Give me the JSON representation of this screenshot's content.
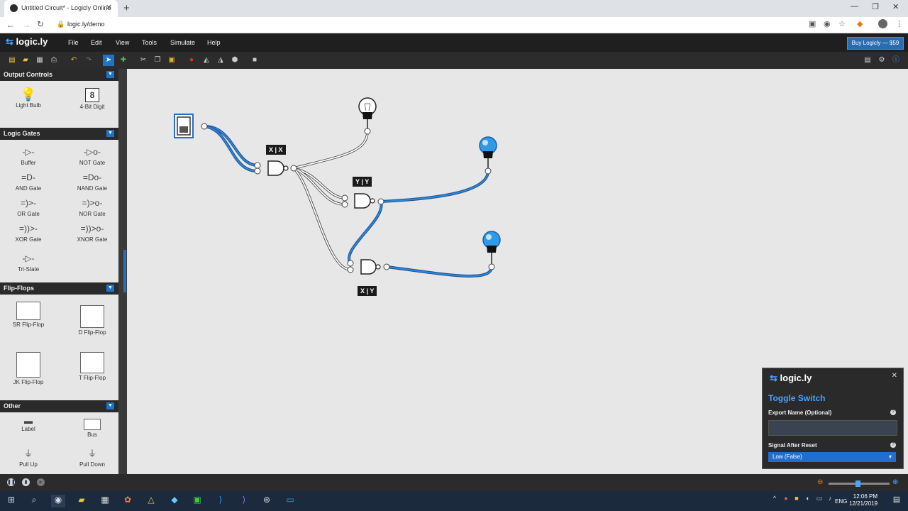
{
  "browser": {
    "tab_title": "Untitled Circuit* - Logicly Online",
    "tab_close": "✕",
    "new_tab": "+",
    "url": "logic.ly/demo",
    "window_controls": [
      "—",
      "❐",
      "✕"
    ]
  },
  "app": {
    "logo": "logic.ly",
    "menu": [
      "File",
      "Edit",
      "View",
      "Tools",
      "Simulate",
      "Help"
    ],
    "buy_button": "Buy Logicly — $59"
  },
  "sidebar": {
    "sections": [
      {
        "title": "Output Controls",
        "items": [
          "Light Bulb",
          "4-Bit Digit"
        ]
      },
      {
        "title": "Logic Gates",
        "items": [
          "Buffer",
          "NOT Gate",
          "AND Gate",
          "NAND Gate",
          "OR Gate",
          "NOR Gate",
          "XOR Gate",
          "XNOR Gate",
          "Tri-State"
        ]
      },
      {
        "title": "Flip-Flops",
        "items": [
          "SR Flip-Flop",
          "D Flip-Flop",
          "JK Flip-Flop",
          "T Flip-Flop"
        ]
      },
      {
        "title": "Other",
        "items": [
          "Label",
          "Bus",
          "Pull Up",
          "Pull Down"
        ]
      }
    ]
  },
  "canvas": {
    "labels": [
      "X | X",
      "Y | Y",
      "X | Y"
    ]
  },
  "properties": {
    "logo": "logic.ly",
    "close": "✕",
    "title": "Toggle Switch",
    "export_name_label": "Export Name (Optional)",
    "export_name_value": "",
    "signal_label": "Signal After Reset",
    "signal_value": "Low (False)"
  },
  "taskbar": {
    "time": "12:06 PM",
    "date": "12/21/2019",
    "lang": "ENG"
  },
  "colors": {
    "wire_on": "#1f6fbf",
    "accent": "#4aa3ff"
  }
}
